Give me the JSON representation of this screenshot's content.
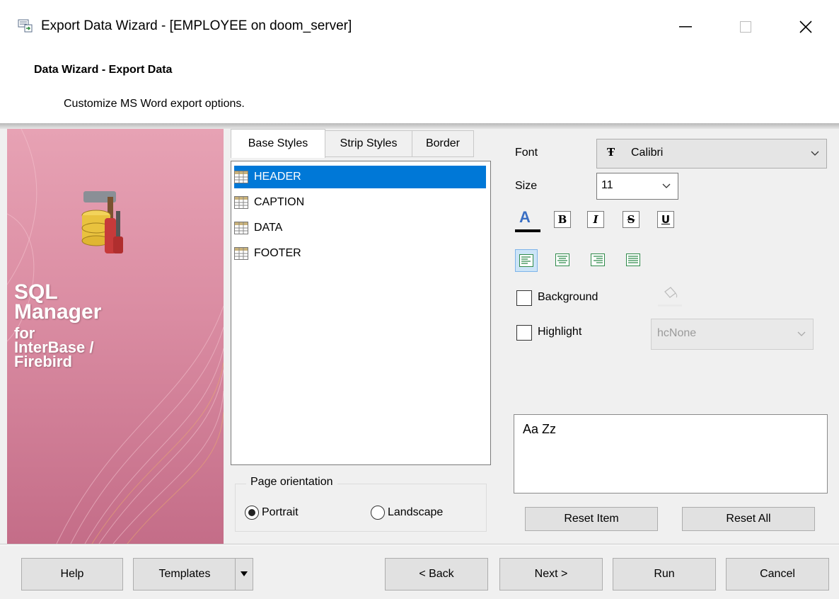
{
  "window": {
    "title": "Export Data Wizard - [EMPLOYEE on doom_server]"
  },
  "header": {
    "title": "Data Wizard - Export Data",
    "subtitle": "Customize MS Word export options."
  },
  "banner": {
    "line1": "SQL",
    "line2": "Manager",
    "line3": "for",
    "line4": "InterBase /",
    "line5": "Firebird"
  },
  "tabs": [
    {
      "label": "Base Styles"
    },
    {
      "label": "Strip Styles"
    },
    {
      "label": "Border"
    }
  ],
  "style_items": [
    {
      "label": "HEADER",
      "selected": true
    },
    {
      "label": "CAPTION"
    },
    {
      "label": "DATA"
    },
    {
      "label": "FOOTER"
    }
  ],
  "page_orientation": {
    "legend": "Page orientation",
    "portrait": "Portrait",
    "landscape": "Landscape",
    "selected": "Portrait"
  },
  "font": {
    "label": "Font",
    "value": "Calibri"
  },
  "size": {
    "label": "Size",
    "value": "11"
  },
  "format_buttons": {
    "bold": "B",
    "italic": "I",
    "strike": "S",
    "underline": "U",
    "font_color": "A"
  },
  "background": {
    "label": "Background",
    "checked": false
  },
  "highlight": {
    "label": "Highlight",
    "checked": false,
    "value": "hcNone"
  },
  "preview": {
    "text": "Aa Zz"
  },
  "reset_item": "Reset Item",
  "reset_all": "Reset All",
  "footer": {
    "help": "Help",
    "templates": "Templates",
    "back": "< Back",
    "next": "Next >",
    "run": "Run",
    "cancel": "Cancel"
  },
  "colors": {
    "accent": "#0078d7",
    "font_color": "#3a6fc4",
    "banner": "#d98aa1"
  }
}
